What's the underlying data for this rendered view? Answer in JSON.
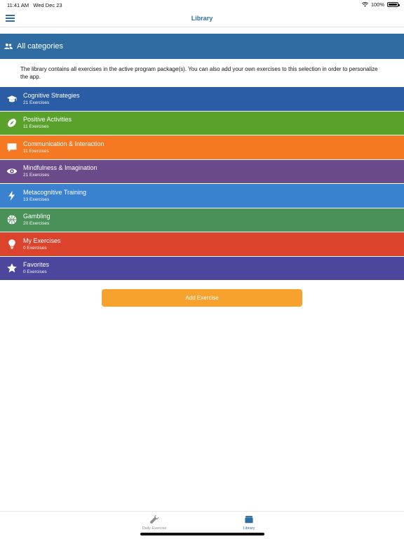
{
  "status": {
    "time": "11:41 AM",
    "date": "Wed Dec 23",
    "battery": "100%"
  },
  "nav": {
    "title": "Library"
  },
  "header": {
    "label": "All categories"
  },
  "description": "The library contains all exercises in the active program package(s). You can also add your own exercises to this selection in order to personalize the app.",
  "categories": [
    {
      "title": "Cognitive Strategies",
      "count": "21 Exercises",
      "color": "#2a5da6",
      "icon": "graduation-cap-icon"
    },
    {
      "title": "Positive Activities",
      "count": "11 Exercises",
      "color": "#5aa12c",
      "icon": "football-icon"
    },
    {
      "title": "Communication & Interaction",
      "count": "11 Exercises",
      "color": "#f57822",
      "icon": "speech-bubble-icon"
    },
    {
      "title": "Mindfulness & Imagination",
      "count": "21 Exercises",
      "color": "#6a4a89",
      "icon": "eye-icon"
    },
    {
      "title": "Metacognitive Training",
      "count": "13 Exercises",
      "color": "#3a81cf",
      "icon": "lightning-icon"
    },
    {
      "title": "Gambling",
      "count": "20 Exercises",
      "color": "#4a9159",
      "icon": "basketball-icon"
    },
    {
      "title": "My Exercises",
      "count": "0 Exercises",
      "color": "#dc432d",
      "icon": "lightbulb-icon"
    },
    {
      "title": "Favorites",
      "count": "0 Exercises",
      "color": "#4a479d",
      "icon": "star-icon"
    }
  ],
  "add_button": {
    "label": "Add Exercise"
  },
  "tabs": [
    {
      "label": "Daily Exercise",
      "icon": "wrench-icon"
    },
    {
      "label": "Library",
      "icon": "archive-box-icon"
    }
  ]
}
